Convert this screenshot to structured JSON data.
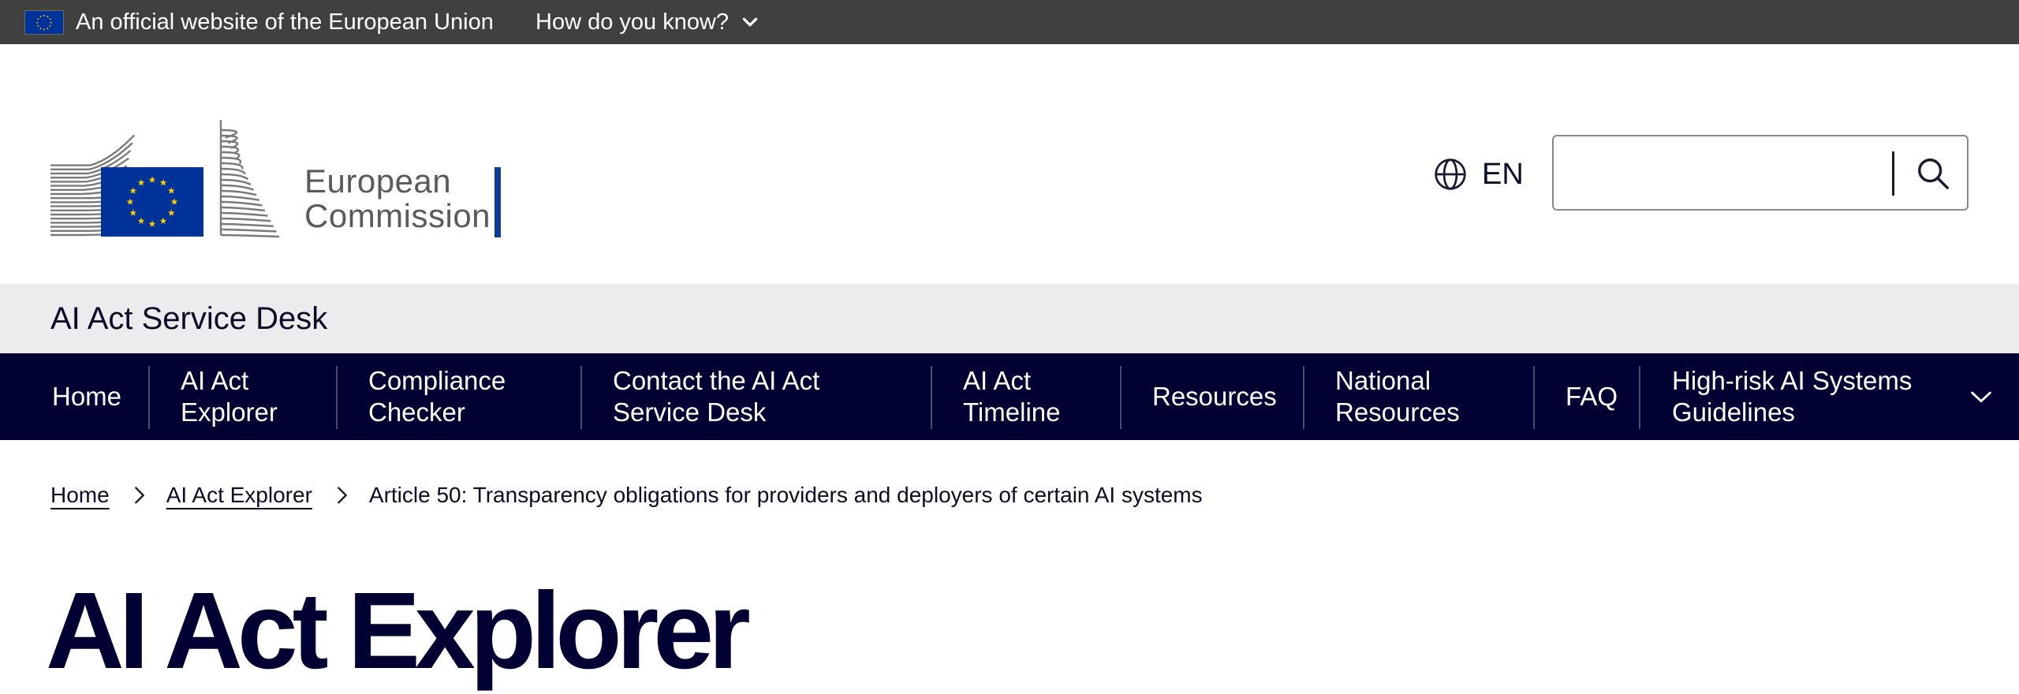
{
  "eu_banner": {
    "official_text": "An official website of the European Union",
    "how_do_you_know": "How do you know?"
  },
  "header": {
    "logo_line1": "European",
    "logo_line2": "Commission",
    "language": "EN",
    "search": {
      "value": "",
      "placeholder": ""
    }
  },
  "site": {
    "name": "AI Act Service Desk"
  },
  "nav": {
    "items": [
      {
        "label_line1": "Home",
        "label_line2": ""
      },
      {
        "label_line1": "AI Act",
        "label_line2": "Explorer"
      },
      {
        "label_line1": "Compliance",
        "label_line2": "Checker"
      },
      {
        "label_line1": "Contact the AI Act",
        "label_line2": "Service Desk"
      },
      {
        "label_line1": "AI Act",
        "label_line2": "Timeline"
      },
      {
        "label_line1": "Resources",
        "label_line2": ""
      },
      {
        "label_line1": "National",
        "label_line2": "Resources"
      },
      {
        "label_line1": "FAQ",
        "label_line2": ""
      },
      {
        "label_line1": "High-risk AI Systems",
        "label_line2": "Guidelines"
      }
    ]
  },
  "breadcrumb": {
    "items": [
      "Home",
      "AI Act Explorer"
    ],
    "current": "Article 50: Transparency obligations for providers and deployers of certain AI systems"
  },
  "page": {
    "title": "AI Act Explorer"
  },
  "colors": {
    "banner_bg": "#404040",
    "nav_bg": "#000033",
    "site_bar_bg": "#ececee",
    "eu_blue": "#003399",
    "eu_yellow": "#ffcc00"
  },
  "icons": {
    "banner_chevron": "chevron-down-icon",
    "language": "globe-icon",
    "search": "search-icon",
    "nav_more": "chevron-down-icon",
    "breadcrumb_separator": "chevron-right-icon"
  }
}
